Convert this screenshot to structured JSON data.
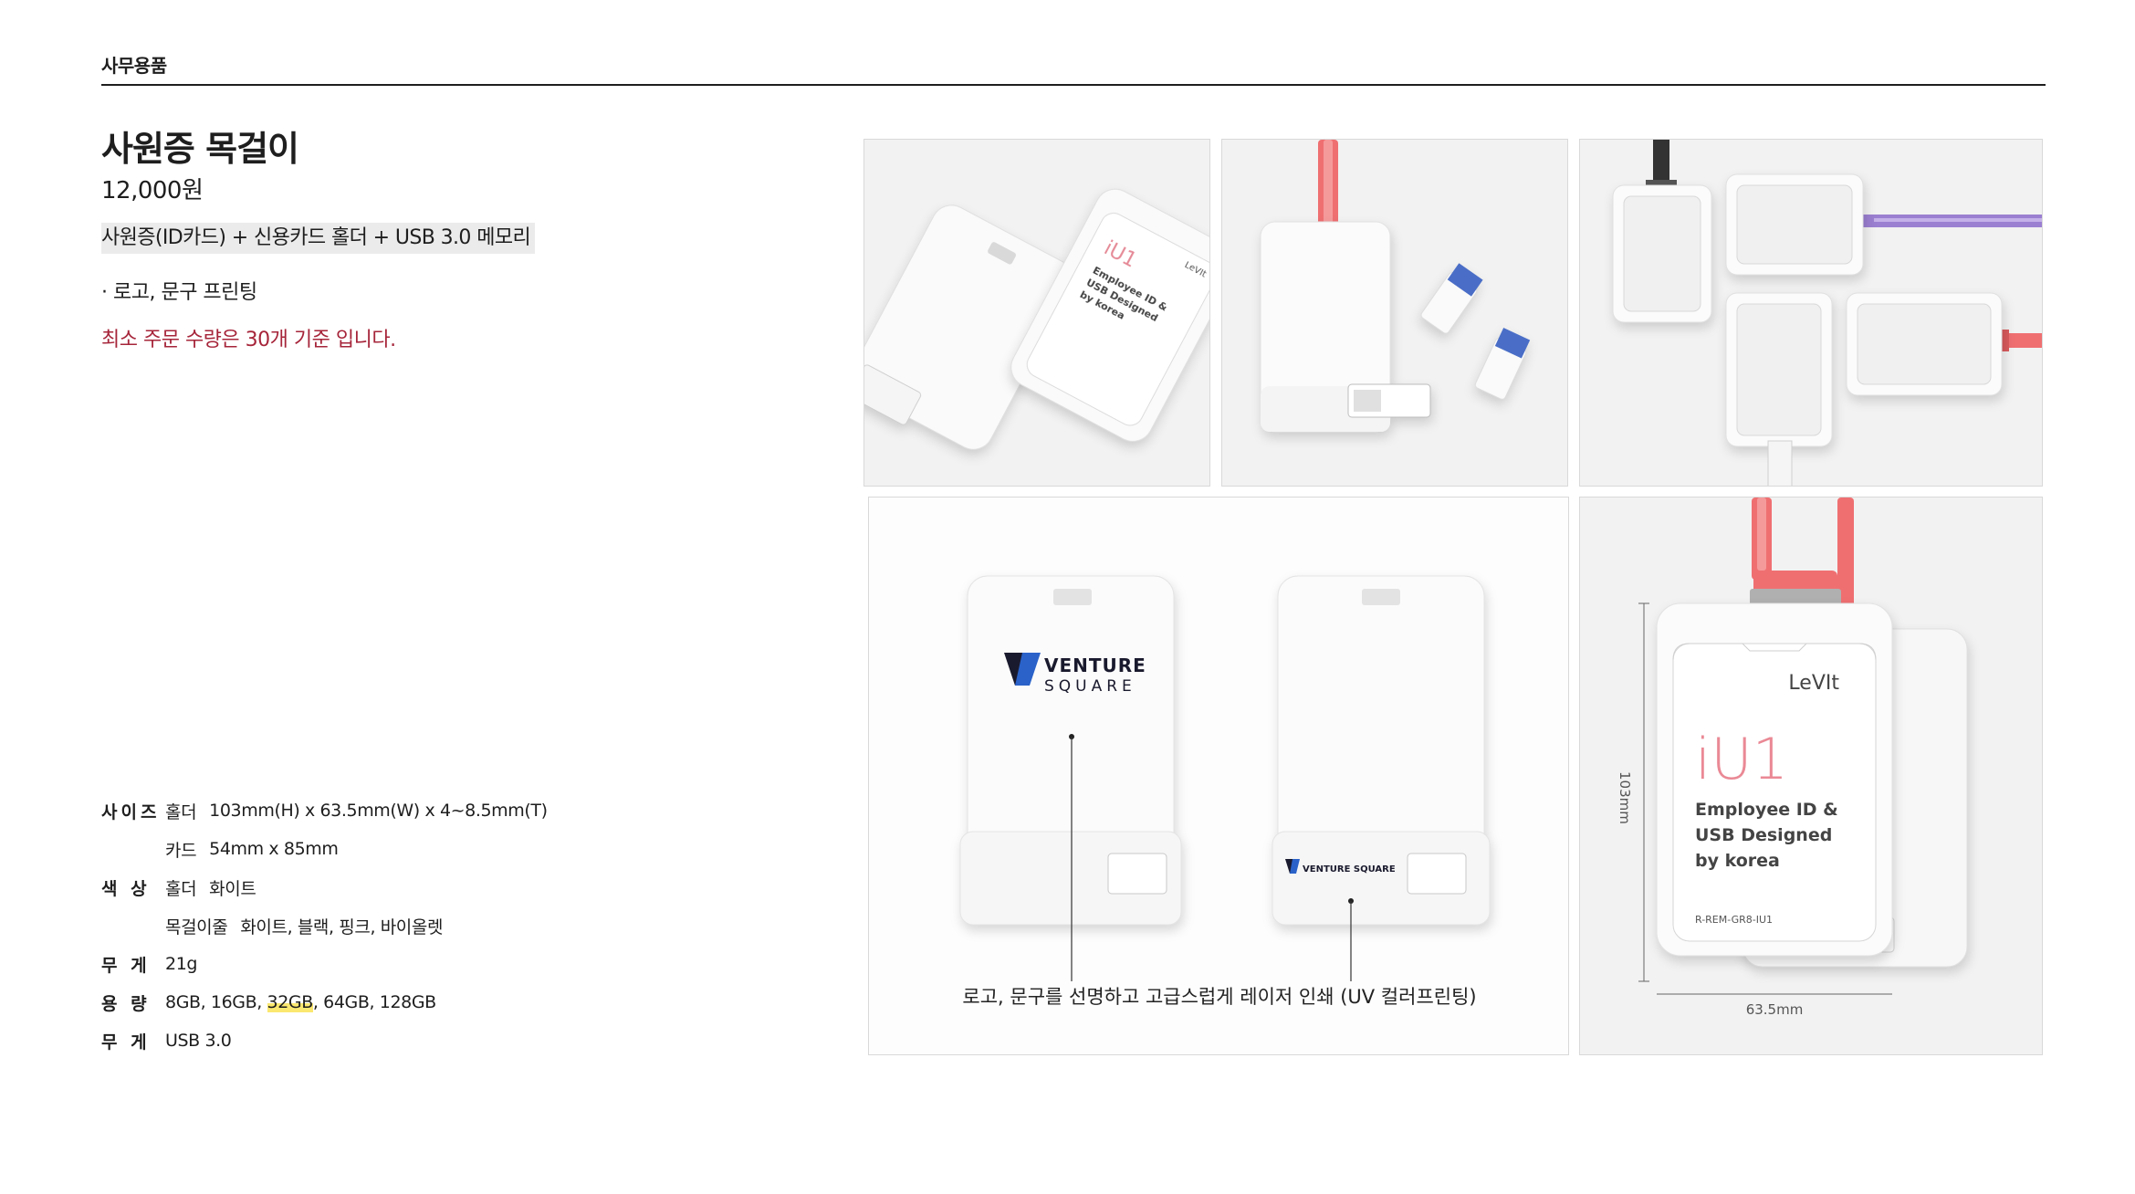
{
  "page": {
    "section_label": "사무용품",
    "product": {
      "title": "사원증 목걸이",
      "price": "12,000원",
      "components": "사원증(ID카드) + 신용카드 홀더 + USB 3.0 메모리",
      "feature": "· 로고, 문구 프린팅",
      "min_order_note": "최소 주문 수량은 30개 기준 입니다."
    },
    "specs": {
      "size": {
        "key": "사이즈",
        "holder_label": "홀더",
        "holder_value": "103mm(H) x 63.5mm(W) x 4~8.5mm(T)",
        "card_label": "카드",
        "card_value": "54mm x 85mm"
      },
      "color": {
        "key": "색 상",
        "holder_label": "홀더",
        "holder_value": "화이트",
        "strap_label": "목걸이줄",
        "strap_value": "화이트, 블랙, 핑크, 바이올렛"
      },
      "weight": {
        "key": "무 게",
        "value": "21g"
      },
      "capacity": {
        "key": "용 량",
        "before": "8GB, 16GB, ",
        "highlight": "32GB",
        "after": ", 64GB, 128GB"
      },
      "usb": {
        "key": "무 게",
        "value": "USB 3.0"
      }
    }
  },
  "images": {
    "holder_brand": "LeVIt",
    "holder_model": "iU1",
    "holder_text_lines": [
      "Employee ID &",
      "USB Designed",
      "by korea"
    ],
    "holder_code": "R-REM-GR8-IU1",
    "logo_word_1": "VENTURE",
    "logo_word_2": "SQUARE",
    "logo_small": "VENTURE SQUARE",
    "print_caption": "로고, 문구를 선명하고 고급스럽게 레이저 인쇄 (UV 컬러프린팅)",
    "dim_height": "103mm",
    "dim_width": "63.5mm"
  },
  "colors": {
    "accent_red": "#a6253a",
    "strap_pink": "#ef6f71",
    "strap_violet": "#9b7fd1",
    "strap_black": "#333333",
    "highlight": "#fbe870"
  }
}
